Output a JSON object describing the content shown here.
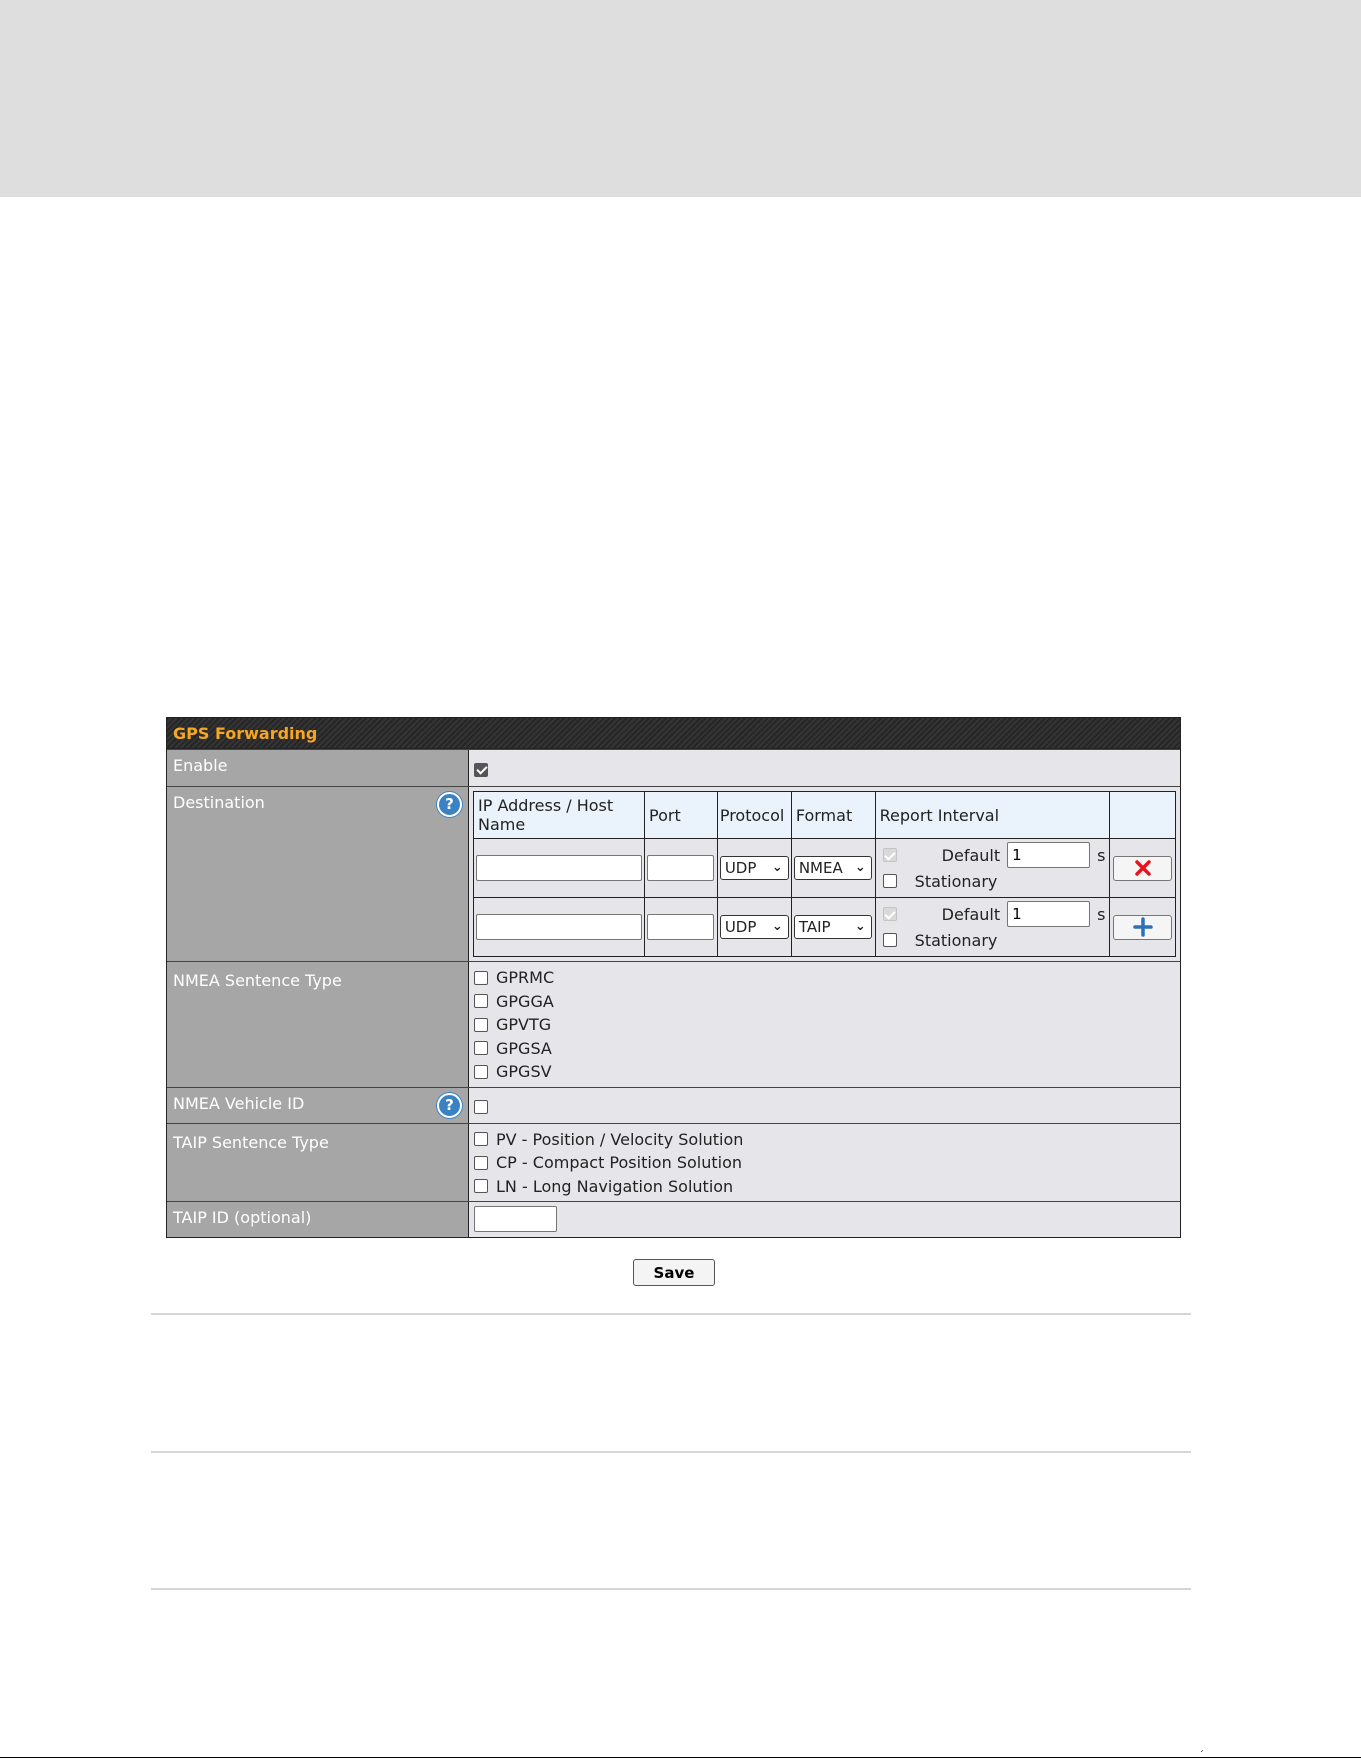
{
  "panel": {
    "title": "GPS Forwarding",
    "save_label": "Save"
  },
  "enable": {
    "label": "Enable",
    "checked": true
  },
  "destination": {
    "label": "Destination",
    "help_icon": "question-circle-icon",
    "columns": [
      "IP Address / Host Name",
      "Port",
      "Protocol",
      "Format",
      "Report Interval"
    ],
    "rows": [
      {
        "ip": "",
        "port": "",
        "protocol": "UDP",
        "format": "NMEA",
        "default_label": "Default",
        "interval": "1",
        "unit": "s",
        "stationary_label": "Stationary",
        "action_icon": "red-x-delete-icon"
      },
      {
        "ip": "",
        "port": "",
        "protocol": "UDP",
        "format": "TAIP",
        "default_label": "Default",
        "interval": "1",
        "unit": "s",
        "stationary_label": "Stationary",
        "action_icon": "blue-plus-add-icon"
      }
    ]
  },
  "nmea_sentence_type": {
    "label": "NMEA Sentence Type",
    "options": [
      "GPRMC",
      "GPGGA",
      "GPVTG",
      "GPGSA",
      "GPGSV"
    ]
  },
  "nmea_vehicle_id": {
    "label": "NMEA Vehicle ID",
    "help_icon": "question-circle-icon"
  },
  "taip_sentence_type": {
    "label": "TAIP Sentence Type",
    "options": [
      "PV - Position / Velocity Solution",
      "CP - Compact Position Solution",
      "LN - Long Navigation Solution"
    ]
  },
  "taip_id": {
    "label": "TAIP ID (optional)",
    "value": ""
  },
  "footer": {
    "corner_mark": "´"
  },
  "colors": {
    "header_text": "#f5a623",
    "label_bg": "#a6a6a6",
    "value_bg": "#e6e6ea",
    "delete_red": "#e8141b",
    "add_blue": "#2f6fba"
  }
}
